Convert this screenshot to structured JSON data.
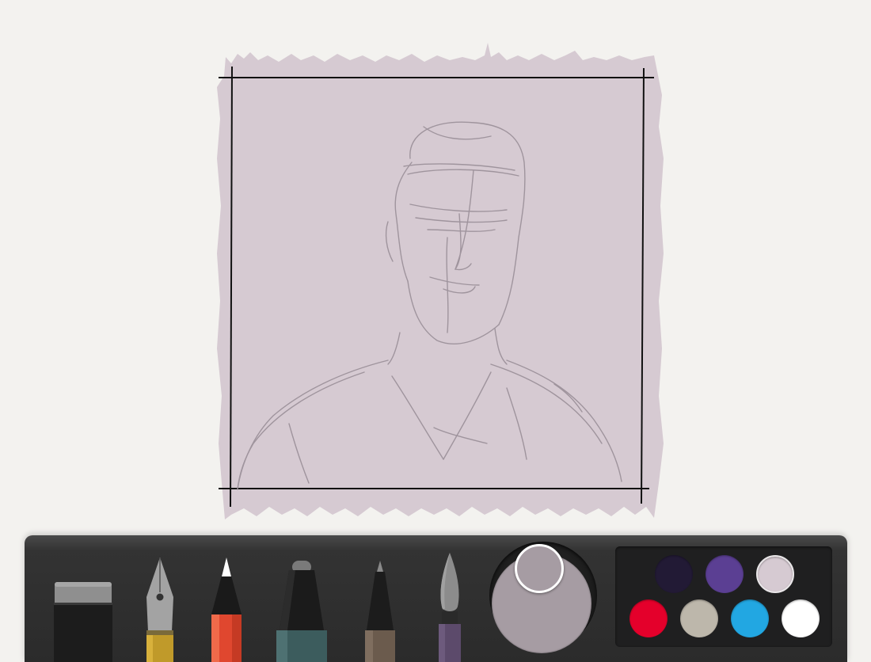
{
  "canvas": {
    "frame_fill": "#d6cad2",
    "frame_line_color": "#111111",
    "sketch_line_color": "#9a8f98"
  },
  "tools": [
    {
      "name": "eraser",
      "icon": "eraser-icon"
    },
    {
      "name": "fountain-pen",
      "icon": "fountain-pen-icon"
    },
    {
      "name": "pencil",
      "icon": "pencil-icon"
    },
    {
      "name": "marker",
      "icon": "marker-icon"
    },
    {
      "name": "outliner",
      "icon": "outliner-icon"
    },
    {
      "name": "watercolor-brush",
      "icon": "brush-icon"
    }
  ],
  "mixer": {
    "current_color": "#a69ca3"
  },
  "palette": {
    "swatches": [
      {
        "color": "#221a35",
        "selected": false
      },
      {
        "color": "#5b3f93",
        "selected": false
      },
      {
        "color": "#d6cad2",
        "selected": true
      },
      {
        "color": "#e4002b",
        "selected": false
      },
      {
        "color": "#bdb7ab",
        "selected": false
      },
      {
        "color": "#22a7e2",
        "selected": false
      },
      {
        "color": "#ffffff",
        "selected": false
      }
    ]
  }
}
